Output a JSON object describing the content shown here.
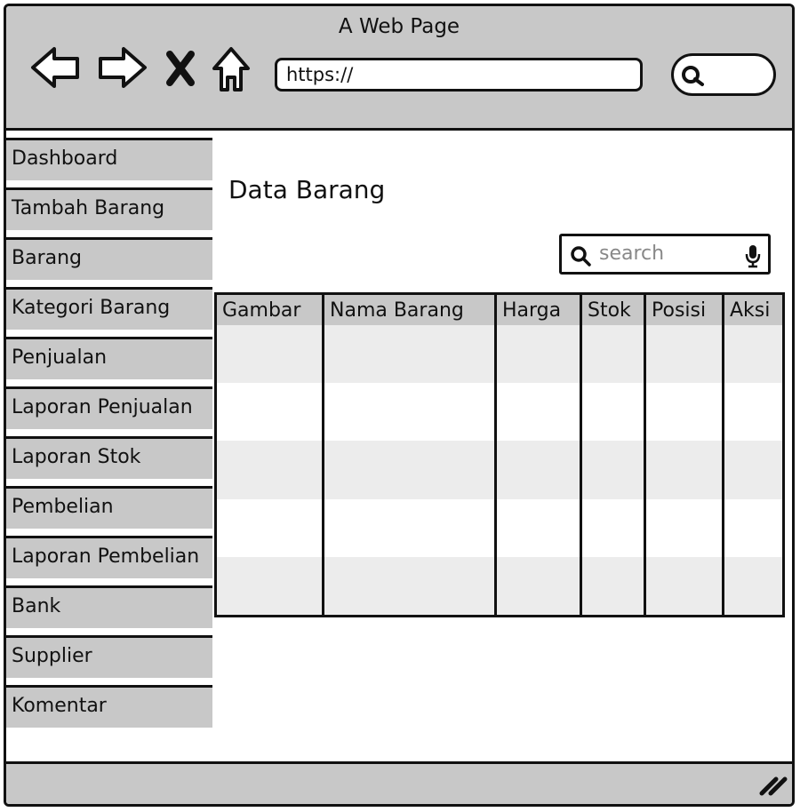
{
  "window": {
    "title": "A Web Page"
  },
  "browser": {
    "url": "https://",
    "nav_icons": [
      "back-arrow-icon",
      "forward-arrow-icon",
      "close-x-icon",
      "home-icon"
    ],
    "search_icon": "search-icon"
  },
  "sidebar": {
    "items": [
      {
        "label": "Dashboard"
      },
      {
        "label": "Tambah Barang"
      },
      {
        "label": "Barang"
      },
      {
        "label": "Kategori Barang"
      },
      {
        "label": "Penjualan"
      },
      {
        "label": "Laporan Penjualan"
      },
      {
        "label": "Laporan Stok"
      },
      {
        "label": "Pembelian"
      },
      {
        "label": "Laporan Pembelian"
      },
      {
        "label": "Bank"
      },
      {
        "label": "Supplier"
      },
      {
        "label": "Komentar"
      }
    ]
  },
  "main": {
    "title": "Data Barang",
    "search": {
      "placeholder": "search",
      "icon": "search-icon",
      "mic_icon": "microphone-icon"
    },
    "table": {
      "columns": [
        "Gambar",
        "Nama Barang",
        "Harga",
        "Stok",
        "Posisi",
        "Aksi"
      ],
      "rows": [
        [
          "",
          "",
          "",
          "",
          "",
          ""
        ],
        [
          "",
          "",
          "",
          "",
          "",
          ""
        ],
        [
          "",
          "",
          "",
          "",
          "",
          ""
        ],
        [
          "",
          "",
          "",
          "",
          "",
          ""
        ],
        [
          "",
          "",
          "",
          "",
          "",
          ""
        ]
      ]
    }
  },
  "colors": {
    "chrome": "#c8c8c8",
    "stripe": "#ececec",
    "ink": "#111111"
  }
}
